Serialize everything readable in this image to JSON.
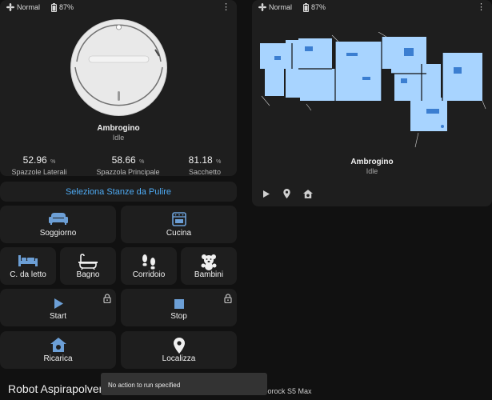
{
  "left_card": {
    "fan_mode": "Normal",
    "battery": "87%",
    "robot_name": "Ambrogino",
    "status": "Idle",
    "stats": [
      {
        "value": "52.96",
        "unit": "%",
        "label": "Spazzole Laterali"
      },
      {
        "value": "58.66",
        "unit": "%",
        "label": "Spazzola Principale"
      },
      {
        "value": "81.18",
        "unit": "%",
        "label": "Sacchetto"
      }
    ]
  },
  "room_select": {
    "label": "Seleziona Stanze da Pulire"
  },
  "rooms": {
    "soggiorno": "Soggiorno",
    "cucina": "Cucina",
    "camera": "C. da letto",
    "bagno": "Bagno",
    "corridoio": "Corridoio",
    "bambini": "Bambini"
  },
  "actions": {
    "start": "Start",
    "stop": "Stop",
    "ricarica": "Ricarica",
    "localizza": "Localizza"
  },
  "right_card": {
    "fan_mode": "Normal",
    "battery": "87%",
    "robot_name": "Ambrogino",
    "status": "Idle"
  },
  "toast": {
    "message": "No action to run specified"
  },
  "bottom": {
    "title": "Robot Aspirapolvere",
    "subtitle": "Roborock S5 Max"
  },
  "colors": {
    "background": "#111111",
    "card": "#1e1e1e",
    "accent": "#4eaaf2",
    "icon_blue": "#6c9fd6",
    "map_blue": "#a8d4ff"
  }
}
